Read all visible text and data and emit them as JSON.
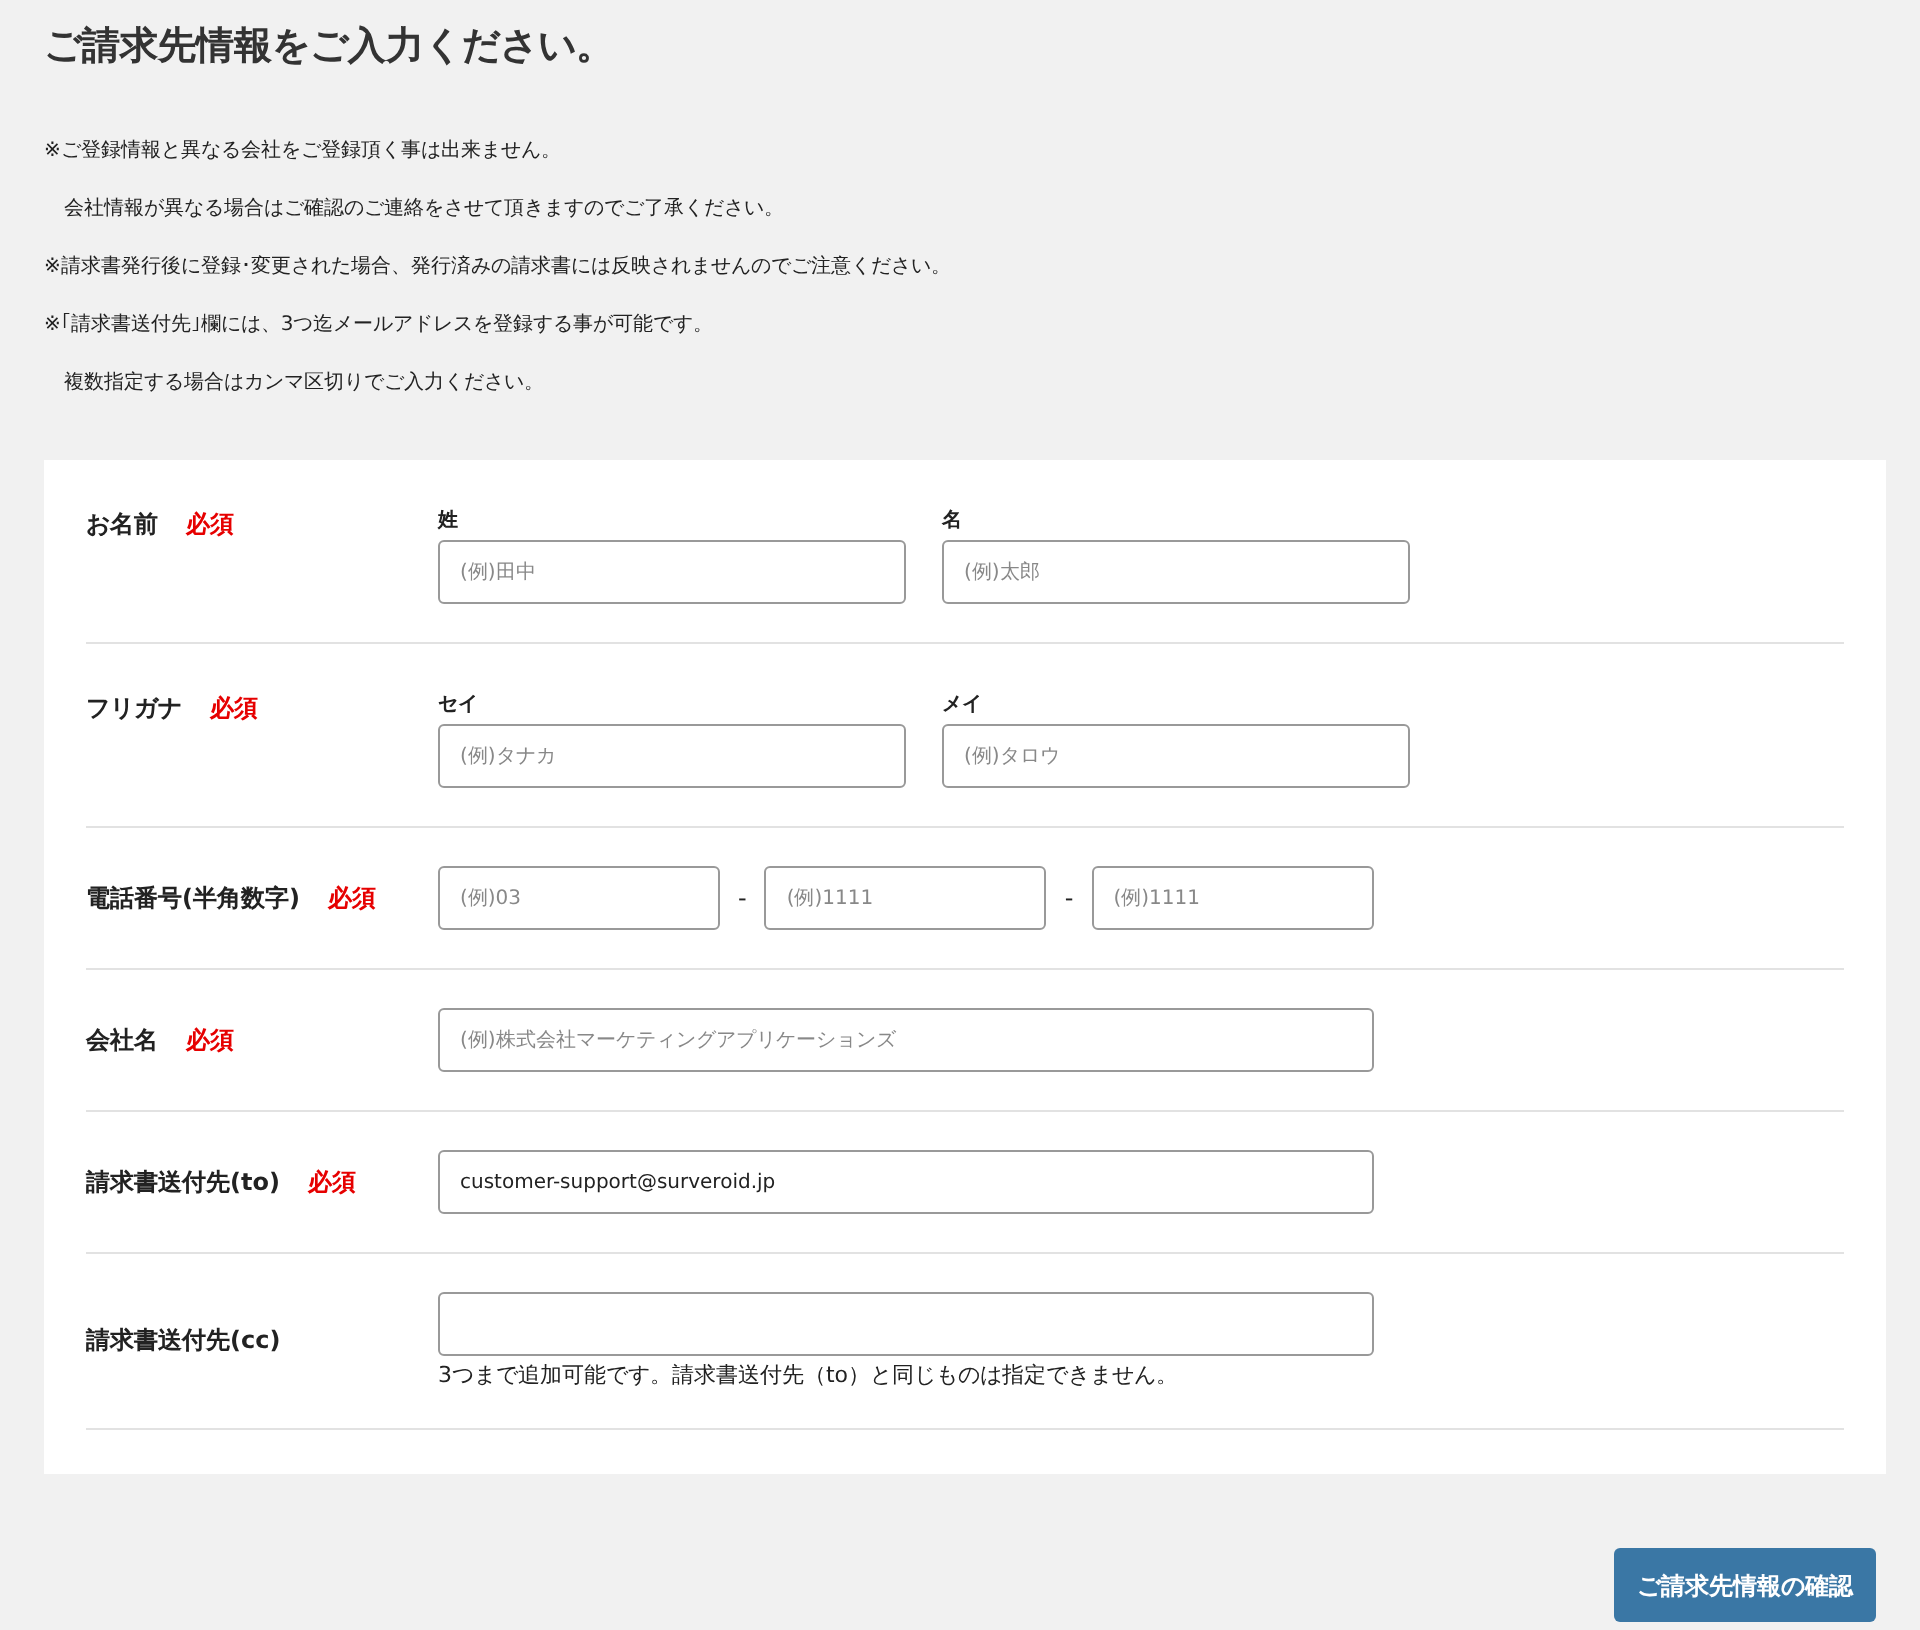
{
  "title": "ご請求先情報をご入力ください。",
  "notes": [
    "※ご登録情報と異なる会社をご登録頂く事は出来ません。",
    "会社情報が異なる場合はご確認のご連絡をさせて頂きますのでご了承ください。",
    "※請求書発行後に登録･変更された場合、発行済みの請求書には反映されませんのでご注意ください。",
    "※｢請求書送付先｣欄には、3つ迄メールアドレスを登録する事が可能です。",
    "複数指定する場合はカンマ区切りでご入力ください。"
  ],
  "form": [
    {
      "kind": "pair",
      "label": "お名前",
      "required": "必須",
      "fields": [
        {
          "sub_label": "姓",
          "placeholder": "(例)田中"
        },
        {
          "sub_label": "名",
          "placeholder": "(例)太郎"
        }
      ]
    },
    {
      "kind": "pair",
      "label": "フリガナ",
      "required": "必須",
      "fields": [
        {
          "sub_label": "セイ",
          "placeholder": "(例)タナカ"
        },
        {
          "sub_label": "メイ",
          "placeholder": "(例)タロウ"
        }
      ]
    },
    {
      "kind": "phone",
      "label": "電話番号(半角数字)",
      "required": "必須",
      "separator": "-",
      "fields": [
        {
          "placeholder": "(例)03"
        },
        {
          "placeholder": "(例)1111"
        },
        {
          "placeholder": "(例)1111"
        }
      ]
    },
    {
      "kind": "single",
      "label": "会社名",
      "required": "必須",
      "fields": [
        {
          "placeholder": "(例)株式会社マーケティングアプリケーションズ"
        }
      ]
    },
    {
      "kind": "single",
      "label": "請求書送付先(to)",
      "required": "必須",
      "fields": [
        {
          "value": "customer-support@surveroid.jp"
        }
      ]
    },
    {
      "kind": "single",
      "label": "請求書送付先(cc)",
      "note": "3つまで追加可能です。請求書送付先（to）と同じものは指定できません。"
    }
  ],
  "submit": "ご請求先情報の確認"
}
